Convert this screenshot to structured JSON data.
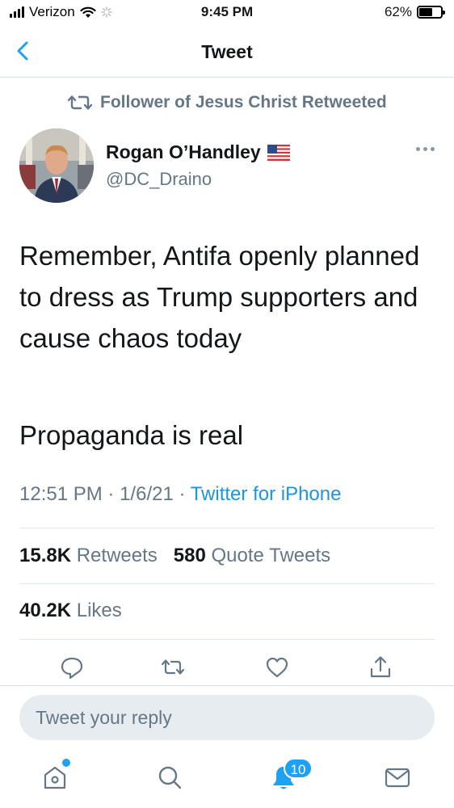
{
  "status_bar": {
    "carrier": "Verizon",
    "time": "9:45 PM",
    "battery_percent": "62%",
    "battery_level": 0.62
  },
  "nav": {
    "title": "Tweet",
    "back_icon": "chevron-left-icon"
  },
  "retweet_context": {
    "text": "Follower of Jesus Christ Retweeted",
    "icon": "retweet-icon"
  },
  "author": {
    "name": "Rogan O’Handley",
    "flag": "🇺🇸",
    "handle": "@DC_Draino"
  },
  "tweet": {
    "text": "Remember, Antifa openly planned to dress as Trump supporters and cause chaos today",
    "text2": "Propaganda is real",
    "time": "12:51 PM",
    "date": "1/6/21",
    "source": "Twitter for iPhone"
  },
  "stats": {
    "retweets_count": "15.8K",
    "retweets_label": "Retweets",
    "quote_count": "580",
    "quote_label": "Quote Tweets",
    "likes_count": "40.2K",
    "likes_label": "Likes"
  },
  "actions": [
    "reply-icon",
    "retweet-icon",
    "like-icon",
    "share-icon"
  ],
  "reply": {
    "placeholder": "Tweet your reply"
  },
  "tab_bar": {
    "items": [
      "home-icon",
      "search-icon",
      "notifications-icon",
      "messages-icon"
    ],
    "notification_badge": "10"
  },
  "colors": {
    "accent": "#1da1f2",
    "secondary_text": "#657786",
    "primary_text": "#14171a"
  }
}
